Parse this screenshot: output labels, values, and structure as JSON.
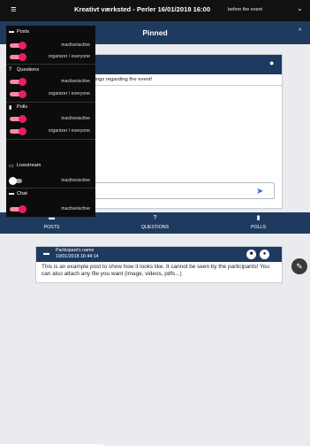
{
  "app": {
    "title": "Kreativt værksted - Perler  16/01/2018 16:00",
    "when": "before the event"
  },
  "pinned": {
    "label": "Pinned",
    "text": "all things regarding the event!"
  },
  "tabs": [
    {
      "label": "POSTS"
    },
    {
      "label": "QUESTIONS"
    },
    {
      "label": "POLLS"
    }
  ],
  "post": {
    "name": "Participant's name",
    "date": "19/01/2018 16:44:14",
    "body": "This is an example post to show how it looks like. It cannot be seen by the participants! You can also attach any file you want (image, videos, pdfs...)"
  },
  "menu": {
    "sections": [
      {
        "label": "Posts",
        "icon": "posts-icon",
        "rows": [
          {
            "label": "inactive/active",
            "on": true
          },
          {
            "label": "organizer / everyone",
            "on": true
          }
        ]
      },
      {
        "label": "Questions",
        "icon": "questions-icon",
        "rows": [
          {
            "label": "inactive/active",
            "on": true
          },
          {
            "label": "organizer / everyone",
            "on": true
          }
        ]
      },
      {
        "label": "Polls",
        "icon": "polls-icon",
        "rows": [
          {
            "label": "inactive/active",
            "on": true
          },
          {
            "label": "organizer / everyone",
            "on": true
          }
        ]
      },
      {
        "label": "Livestream",
        "icon": "livestream-icon",
        "rows": [
          {
            "label": "inactive/active",
            "on": false
          }
        ]
      },
      {
        "label": "Chat",
        "icon": "chat-icon",
        "rows": [
          {
            "label": "inactive/active",
            "on": true
          }
        ]
      }
    ]
  },
  "colors": {
    "navy": "#1f3a5f",
    "accent": "#e91e63",
    "link": "#2d6cdf"
  }
}
